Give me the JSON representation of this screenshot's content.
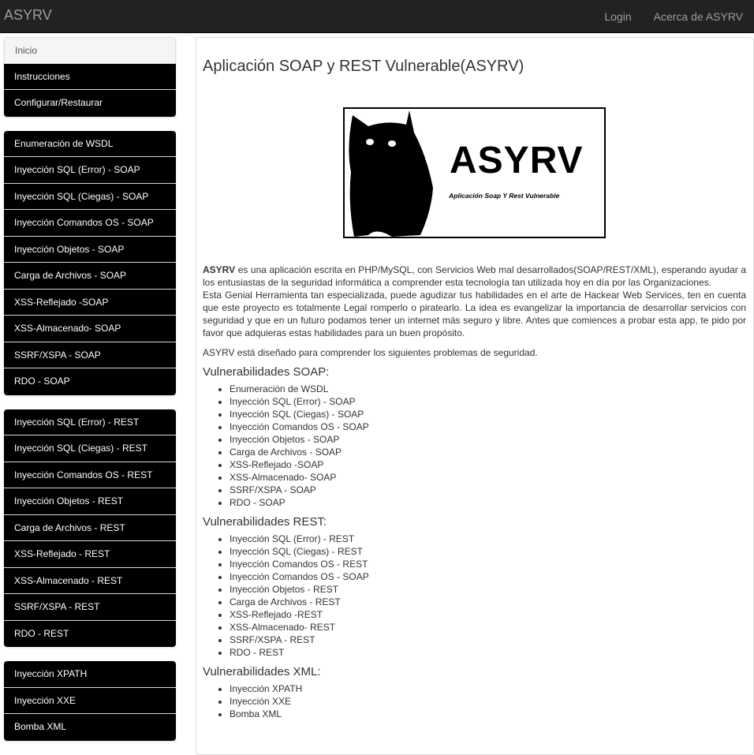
{
  "navbar": {
    "brand": "ASYRV",
    "links": [
      "Login",
      "Acerca de ASYRV"
    ]
  },
  "sidebar": {
    "group1": [
      "Inicio",
      "Instrucciones",
      "Configurar/Restaurar"
    ],
    "group2": [
      "Enumeración de WSDL",
      "Inyección SQL (Error) - SOAP",
      "Inyección SQL (Ciegas) - SOAP",
      "Inyección Comandos OS - SOAP",
      "Inyección Objetos - SOAP",
      "Carga de Archivos - SOAP",
      "XSS-Reflejado -SOAP",
      "XSS-Almacenado- SOAP",
      "SSRF/XSPA - SOAP",
      "RDO - SOAP"
    ],
    "group3": [
      "Inyección SQL (Error) - REST",
      "Inyección SQL (Ciegas) - REST",
      "Inyección Comandos OS - REST",
      "Inyección Objetos - REST",
      "Carga de Archivos - REST",
      "XSS-Reflejado - REST",
      "XSS-Almacenado - REST",
      "SSRF/XSPA - REST",
      "RDO - REST"
    ],
    "group4": [
      "Inyección XPATH",
      "Inyección XXE",
      "Bomba XML"
    ]
  },
  "main": {
    "title": "Aplicación SOAP y REST Vulnerable(ASYRV)",
    "logo": {
      "text": "ASYRV",
      "subtitle": "Aplicación Soap Y Rest Vulnerable",
      "icon": "black-cat-icon"
    },
    "intro_bold": "ASYRV",
    "intro_line1": " es una aplicación escrita en PHP/MySQL, con Servicios Web mal desarrollados(SOAP/REST/XML), esperando ayudar a los entusiastas de la seguridad informática a comprender esta tecnología tan utilizada hoy en día por las Organizaciones.",
    "intro_line2": "Esta Genial Herramienta tan especializada, puede agudizar tus habilidades en el arte de Hackear Web Services, ten en cuenta que este proyecto es totalmente Legal romperlo o piratearlo. La idea es evangelizar la importancia de desarrollar servicios con seguridad y que en un futuro podamos tener un internet más seguro y libre. Antes que comiences a probar esta app, te pido por favor que adquieras estas habilidades para un buen propósito.",
    "summary": "ASYRV está diseñado para comprender los siguientes problemas de seguridad.",
    "sections": [
      {
        "heading": "Vulnerabilidades SOAP:",
        "items": [
          "Enumeración de WSDL",
          "Inyección SQL (Error) - SOAP",
          "Inyección SQL (Ciegas) - SOAP",
          "Inyección Comandos OS - SOAP",
          "Inyección Objetos - SOAP",
          "Carga de Archivos - SOAP",
          "XSS-Reflejado -SOAP",
          "XSS-Almacenado- SOAP",
          "SSRF/XSPA - SOAP",
          "RDO - SOAP"
        ]
      },
      {
        "heading": "Vulnerabilidades REST:",
        "items": [
          "Inyección SQL (Error) - REST",
          "Inyección SQL (Ciegas) - REST",
          "Inyección Comandos OS - REST",
          "Inyección Comandos OS - SOAP",
          "Inyección Objetos - REST",
          "Carga de Archivos - REST",
          "XSS-Reflejado -REST",
          "XSS-Almacenado- REST",
          "SSRF/XSPA - REST",
          "RDO - REST"
        ]
      },
      {
        "heading": "Vulnerabilidades XML:",
        "items": [
          "Inyección XPATH",
          "Inyección XXE",
          "Bomba XML"
        ]
      }
    ]
  },
  "colors": {
    "navbar_bg": "#222222",
    "nav_text": "#9d9d9d",
    "sidebar_item_bg": "#000000",
    "active_item_bg": "#f5f5f5"
  }
}
